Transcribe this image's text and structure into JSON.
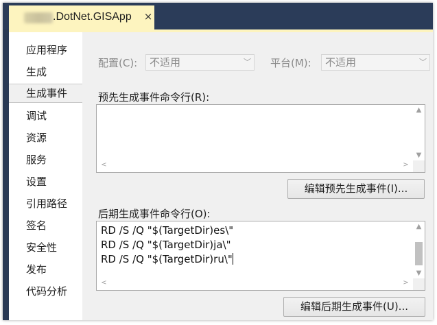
{
  "tab": {
    "title": ".DotNet.GISApp",
    "close_glyph": "×"
  },
  "nav": {
    "items": [
      {
        "label": "应用程序"
      },
      {
        "label": "生成"
      },
      {
        "label": "生成事件"
      },
      {
        "label": "调试"
      },
      {
        "label": "资源"
      },
      {
        "label": "服务"
      },
      {
        "label": "设置"
      },
      {
        "label": "引用路径"
      },
      {
        "label": "签名"
      },
      {
        "label": "安全性"
      },
      {
        "label": "发布"
      },
      {
        "label": "代码分析"
      }
    ],
    "selected": "生成事件"
  },
  "config": {
    "config_label": "配置(C):",
    "config_value": "不适用",
    "platform_label": "平台(M):",
    "platform_value": "不适用"
  },
  "prebuild": {
    "label": "预先生成事件命令行(R):",
    "lines": [],
    "edit_button": "编辑预先生成事件(I)..."
  },
  "postbuild": {
    "label": "后期生成事件命令行(O):",
    "lines": [
      "RD /S /Q \"$(TargetDir)es\\\"",
      "RD /S /Q \"$(TargetDir)ja\\\"",
      "RD /S /Q \"$(TargetDir)ru\\\""
    ],
    "edit_button": "编辑后期生成事件(U)..."
  },
  "icons": {
    "up": "▲",
    "down": "▼",
    "left": "<",
    "right": ">",
    "combo_arrow": "﹀"
  },
  "colors": {
    "frame": "#293955",
    "tab_active": "#fdf4bf",
    "panel": "#f0f0f0"
  }
}
